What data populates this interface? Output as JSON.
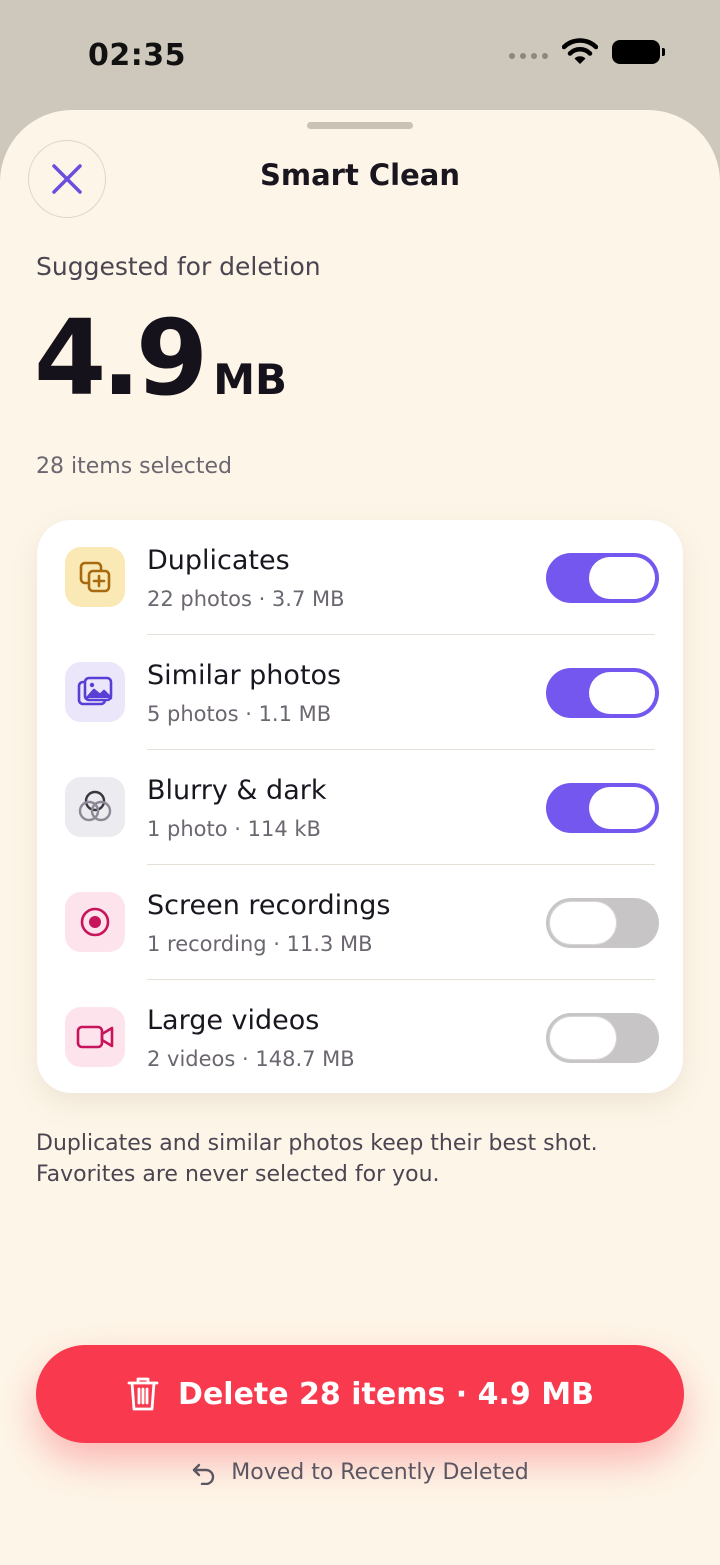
{
  "status_bar": {
    "time": "02:35"
  },
  "sheet": {
    "title": "Smart Clean",
    "suggested_label": "Suggested for deletion",
    "total_size_value": "4.9",
    "total_size_unit": "MB",
    "items_selected": "28 items selected"
  },
  "categories": [
    {
      "title": "Duplicates",
      "subtitle": "22 photos · 3.7 MB",
      "enabled": true,
      "icon": "duplicate-icon",
      "icon_bg": "#fbe9b5",
      "icon_color": "#a86a10"
    },
    {
      "title": "Similar photos",
      "subtitle": "5 photos · 1.1 MB",
      "enabled": true,
      "icon": "photos-icon",
      "icon_bg": "#ece6fb",
      "icon_color": "#5a3fd6"
    },
    {
      "title": "Blurry & dark",
      "subtitle": "1 photo · 114 kB",
      "enabled": true,
      "icon": "blur-circles-icon",
      "icon_bg": "#ecebf0",
      "icon_color": "#3a3640"
    },
    {
      "title": "Screen recordings",
      "subtitle": "1 recording · 11.3 MB",
      "enabled": false,
      "icon": "record-icon",
      "icon_bg": "#fde3ec",
      "icon_color": "#c8145a"
    },
    {
      "title": "Large videos",
      "subtitle": "2 videos · 148.7 MB",
      "enabled": false,
      "icon": "video-camera-icon",
      "icon_bg": "#fde3ec",
      "icon_color": "#c8145a"
    }
  ],
  "footnote": {
    "line1": "Duplicates and similar photos keep their best shot.",
    "line2": "Favorites are never selected for you."
  },
  "actions": {
    "delete_label": "Delete 28 items · 4.9 MB",
    "moved_note": "Moved to Recently Deleted"
  },
  "colors": {
    "accent": "#7357ee",
    "danger": "#f9394d",
    "sheet_bg": "#fdf6e8"
  }
}
